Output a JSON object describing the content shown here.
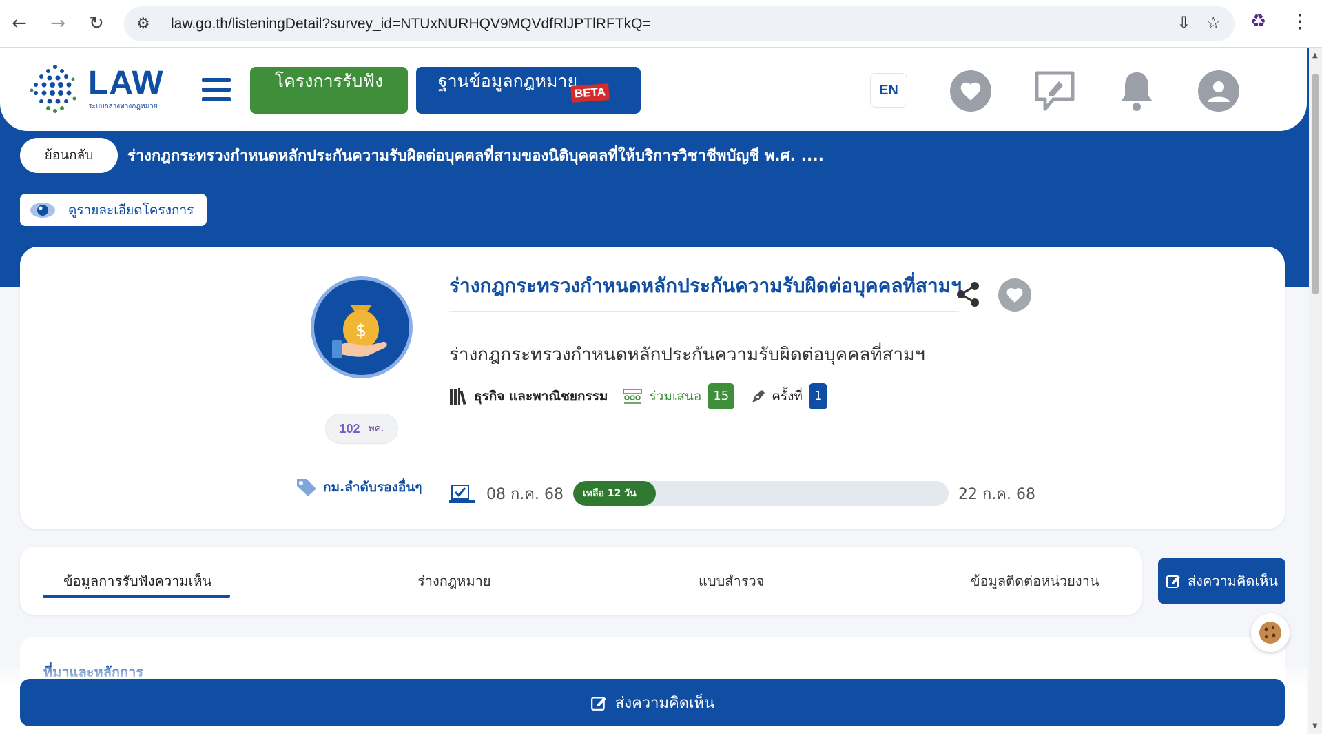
{
  "browser": {
    "url": "law.go.th/listeningDetail?survey_id=NTUxNURHQV9MQVdfRlJPTlRFTkQ="
  },
  "header": {
    "logo_text": "LAW",
    "logo_subtitle": "ระบบกลางทางกฎหมาย",
    "nav_listening": "โครงการรับฟัง",
    "nav_lawdb": "ฐานข้อมูลกฎหมาย",
    "beta": "BETA",
    "lang": "EN"
  },
  "page": {
    "back_label": "ย้อนกลับ",
    "heading": "ร่างกฎกระทรวงกำหนดหลักประกันความรับผิดต่อบุคคลที่สามของนิติบุคคลที่ให้บริการวิชาชีพบัญชี พ.ศ. ....",
    "detail_label": "ดูรายละเอียดโครงการ"
  },
  "project": {
    "title": "ร่างกฎกระทรวงกำหนดหลักประกันความรับผิดต่อบุคคลที่สามฯ",
    "subtitle": "ร่างกฎกระทรวงกำหนดหลักประกันความรับผิดต่อบุคคลที่สามฯ",
    "category": "ธุรกิจ และพาณิชยกรรม",
    "participants_label": "ร่วมเสนอ",
    "participants_count": "15",
    "round_label": "ครั้งที่",
    "round_value": "1",
    "agency_mark": "102",
    "agency_abbr": "พค.",
    "tag": "กม.ลำดับรองอื่นๆ",
    "start_date": "08 ก.ค. 68",
    "end_date": "22 ก.ค. 68",
    "remaining": "เหลือ 12 วัน",
    "remaining_fraction": 0.22
  },
  "tabs": [
    {
      "label": "ข้อมูลการรับฟังความเห็น",
      "active": true
    },
    {
      "label": "ร่างกฎหมาย",
      "active": false
    },
    {
      "label": "แบบสำรวจ",
      "active": false
    },
    {
      "label": "ข้อมูลติดต่อหน่วยงาน",
      "active": false
    }
  ],
  "actions": {
    "send_comment": "ส่งความคิดเห็น",
    "send_comment_bottom": "ส่งความคิดเห็น"
  },
  "content": {
    "section_heading": "ที่มาและหลักการ"
  },
  "colors": {
    "brand_blue": "#0f4ea3",
    "green": "#3f8f3a"
  }
}
